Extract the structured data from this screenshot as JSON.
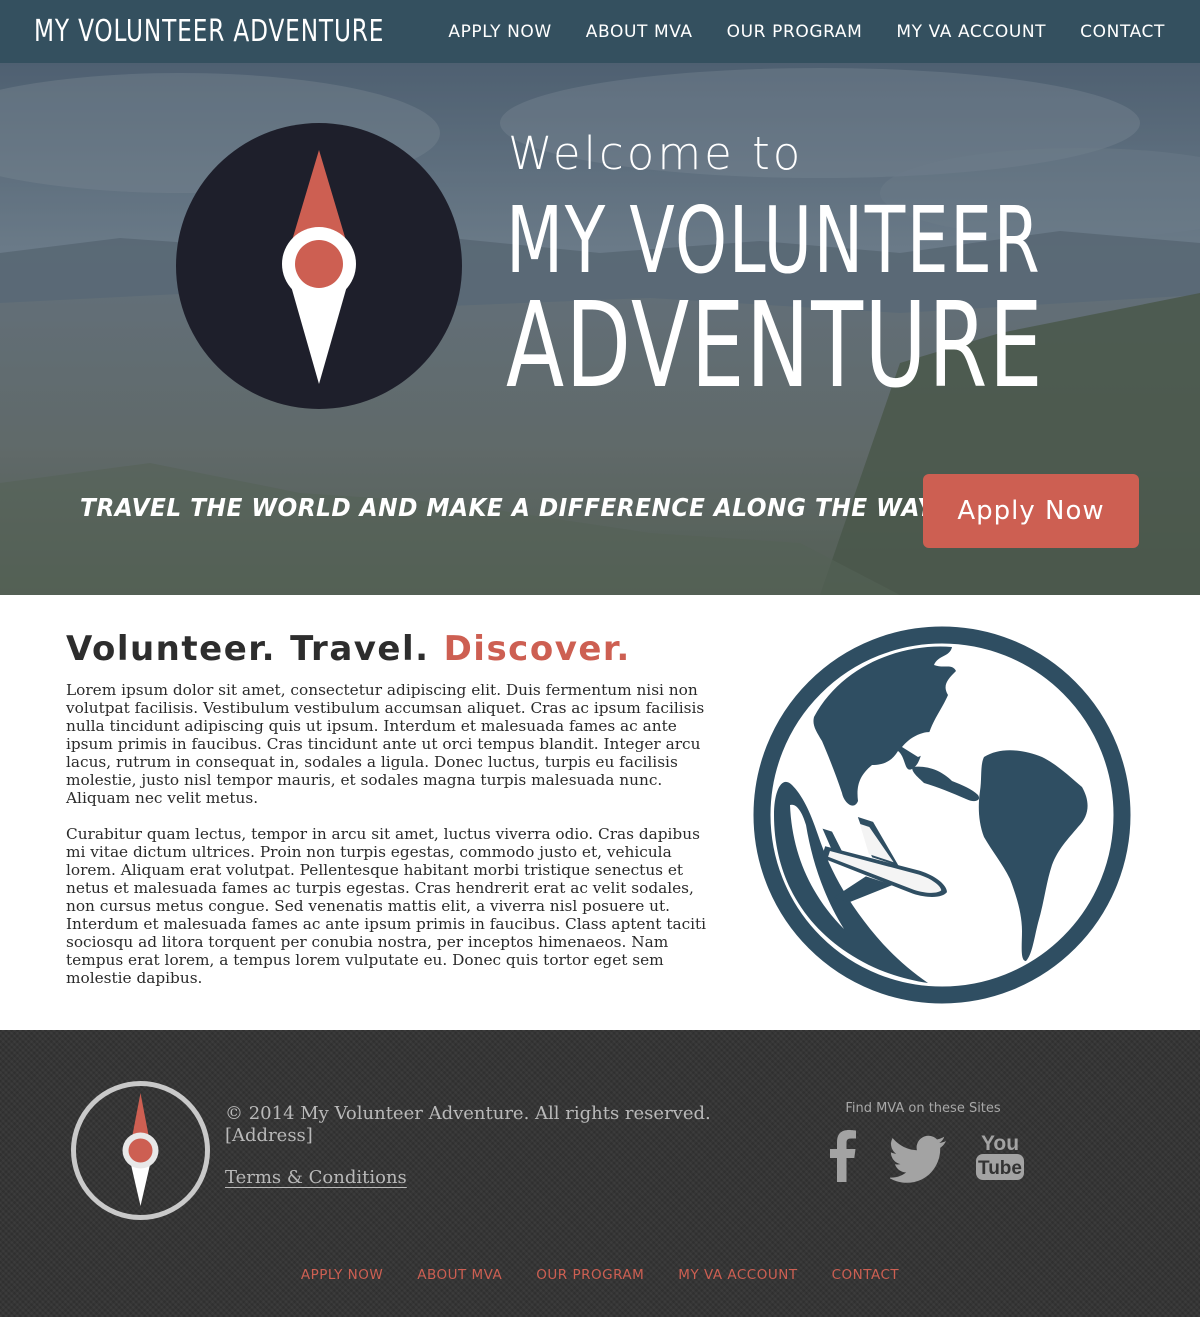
{
  "header": {
    "brand": "MY VOLUNTEER ADVENTURE",
    "nav": [
      "APPLY NOW",
      "ABOUT MVA",
      "OUR PROGRAM",
      "MY VA ACCOUNT",
      "CONTACT"
    ]
  },
  "hero": {
    "welcome": "Welcome to",
    "title_line1": "MY VOLUNTEER",
    "title_line2": "ADVENTURE",
    "tagline": "TRAVEL THE WORLD AND MAKE A DIFFERENCE ALONG THE WAY",
    "apply_label": "Apply Now",
    "icon": "compass-icon"
  },
  "main": {
    "heading_word1": "Volunteer.",
    "heading_word2": "Travel.",
    "heading_word3": "Discover.",
    "paragraph1": "Lorem ipsum dolor sit amet, consectetur adipiscing elit. Duis fermentum nisi non volutpat facilisis. Vestibulum vestibulum accumsan aliquet. Cras ac ipsum facilisis nulla tincidunt adipiscing quis ut ipsum. Interdum et malesuada fames ac ante ipsum primis in faucibus. Cras tincidunt ante ut orci tempus blandit. Integer arcu lacus, rutrum in consequat in, sodales a ligula. Donec luctus, turpis eu facilisis molestie, justo nisl tempor mauris, et sodales magna turpis malesuada nunc. Aliquam nec velit metus.",
    "paragraph2": "Curabitur quam lectus, tempor in arcu sit amet, luctus viverra odio. Cras dapibus mi vitae dictum ultrices. Proin non turpis egestas, commodo justo et, vehicula lorem. Aliquam erat volutpat. Pellentesque habitant morbi tristique senectus et netus et malesuada fames ac turpis egestas. Cras hendrerit erat ac velit sodales, non cursus metus congue. Sed venenatis mattis elit, a viverra nisl posuere ut. Interdum et malesuada fames ac ante ipsum primis in faucibus. Class aptent taciti sociosqu ad litora torquent per conubia nostra, per inceptos himenaeos. Nam tempus erat lorem, a tempus lorem vulputate eu. Donec quis tortor eget sem molestie dapibus.",
    "illustration": "globe-airplane-icon"
  },
  "footer": {
    "copyright": "© 2014 My Volunteer Adventure.  All rights reserved.",
    "address": "[Address]",
    "terms": "Terms & Conditions",
    "find_label": "Find MVA on these Sites",
    "social": [
      "facebook-icon",
      "twitter-icon",
      "youtube-icon"
    ],
    "youtube_top": "You",
    "youtube_bottom": "Tube",
    "nav": [
      "APPLY NOW",
      "ABOUT MVA",
      "OUR PROGRAM",
      "MY VA ACCOUNT",
      "CONTACT"
    ]
  },
  "colors": {
    "nav_bar": "#34505f",
    "accent": "#cd5f52",
    "compass_dark": "#1e1f2b",
    "globe": "#2f4e62",
    "footer_bg": "#333333"
  }
}
